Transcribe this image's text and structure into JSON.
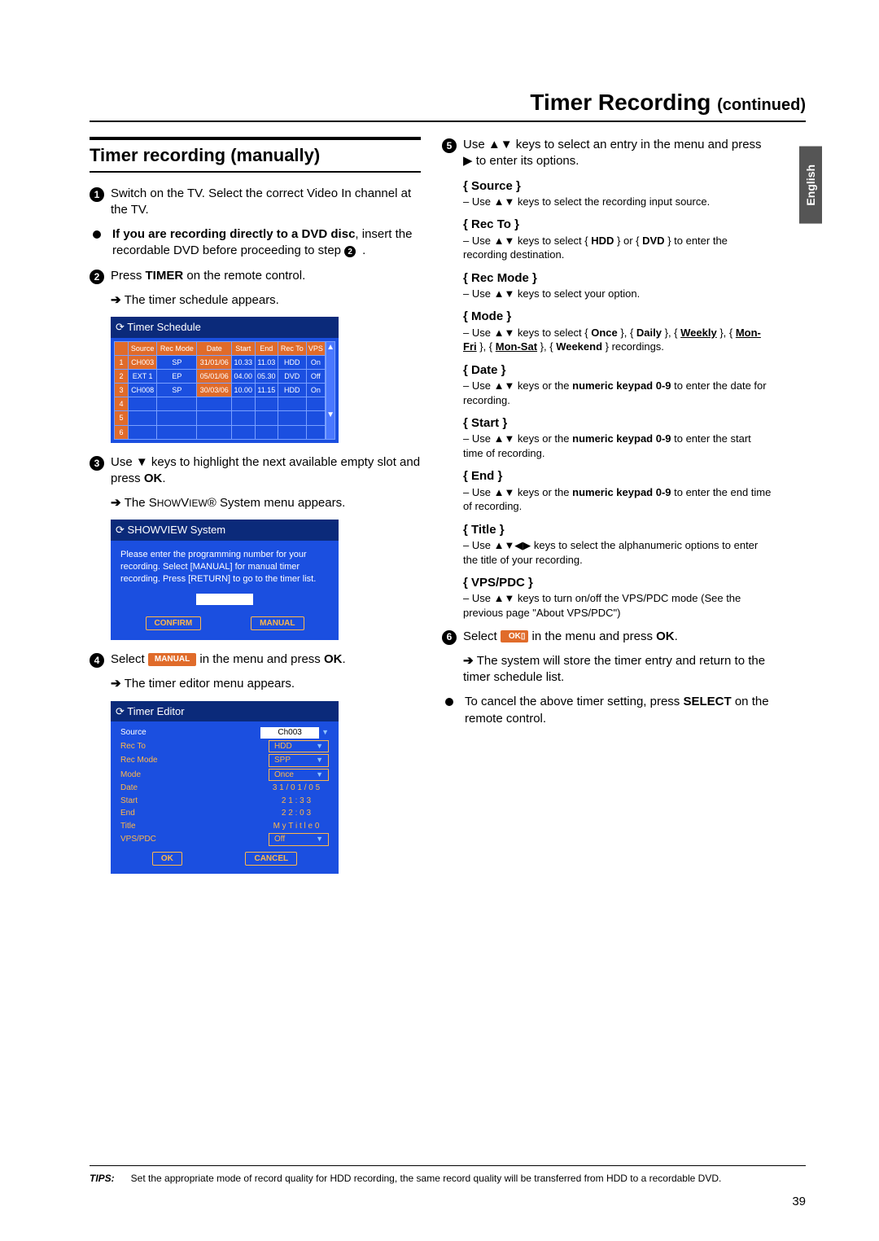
{
  "header": {
    "title": "Timer Recording",
    "continued": "(continued)"
  },
  "lang_tab": "English",
  "left": {
    "section_title": "Timer recording (manually)",
    "step1": "Switch on the TV. Select the correct Video In channel at the TV.",
    "bullet_dvd_a": "If you are recording directly to a DVD disc",
    "bullet_dvd_b": ", insert the recordable DVD before proceeding to step ",
    "bullet_dvd_ref": "2",
    "step2_a": "Press ",
    "step2_b": "TIMER",
    "step2_c": " on the remote control.",
    "step2_sub": "The timer schedule appears.",
    "schedule": {
      "title": "Timer Schedule",
      "headers": [
        "",
        "Source",
        "Rec Mode",
        "Date",
        "Start",
        "End",
        "Rec To",
        "VPS"
      ],
      "rows": [
        {
          "n": "1",
          "source": "CH003",
          "mode": "SP",
          "date": "31/01/06",
          "start": "10.33",
          "end": "11.03",
          "to": "HDD",
          "vps": "On"
        },
        {
          "n": "2",
          "source": "EXT 1",
          "mode": "EP",
          "date": "05/01/06",
          "start": "04.00",
          "end": "05.30",
          "to": "DVD",
          "vps": "Off"
        },
        {
          "n": "3",
          "source": "CH008",
          "mode": "SP",
          "date": "30/03/06",
          "start": "10.00",
          "end": "11.15",
          "to": "HDD",
          "vps": "On"
        },
        {
          "n": "4",
          "source": "",
          "mode": "",
          "date": "",
          "start": "",
          "end": "",
          "to": "",
          "vps": ""
        },
        {
          "n": "5",
          "source": "",
          "mode": "",
          "date": "",
          "start": "",
          "end": "",
          "to": "",
          "vps": ""
        },
        {
          "n": "6",
          "source": "",
          "mode": "",
          "date": "",
          "start": "",
          "end": "",
          "to": "",
          "vps": ""
        }
      ]
    },
    "step3_a": "Use ▼ keys to highlight the next available empty slot and press ",
    "step3_b": "OK",
    "step3_c": ".",
    "step3_sub_a": "The S",
    "step3_sub_b": "HOW",
    "step3_sub_c": "V",
    "step3_sub_d": "IEW",
    "step3_sub_e": "® System menu appears.",
    "sv": {
      "title": "SHOWVIEW System",
      "body": "Please enter the programming number for your recording. Select [MANUAL] for manual timer recording. Press [RETURN] to go to the timer list.",
      "confirm": "CONFIRM",
      "manual": "MANUAL"
    },
    "step4_a": "Select ",
    "step4_chip": "MANUAL",
    "step4_b": " in the menu and press ",
    "step4_c": "OK",
    "step4_d": ".",
    "step4_sub": "The timer editor menu appears.",
    "editor": {
      "title": "Timer Editor",
      "rows": [
        {
          "lbl": "Source",
          "val": "Ch003",
          "boxed": false,
          "sel": true,
          "tri": true
        },
        {
          "lbl": "Rec To",
          "val": "HDD",
          "boxed": true,
          "tri": true
        },
        {
          "lbl": "Rec Mode",
          "val": "SPP",
          "boxed": true,
          "tri": true
        },
        {
          "lbl": "Mode",
          "val": "Once",
          "boxed": true,
          "tri": true
        },
        {
          "lbl": "Date",
          "val": "3 1 / 0 1 / 0 5",
          "plain": true
        },
        {
          "lbl": "Start",
          "val": "2 1 : 3 3",
          "plain": true
        },
        {
          "lbl": "End",
          "val": "2 2 : 0 3",
          "plain": true
        },
        {
          "lbl": "Title",
          "val": "M y T i t l e 0",
          "plain": true
        },
        {
          "lbl": "VPS/PDC",
          "val": "Off",
          "boxed": true,
          "tri": true
        }
      ],
      "ok": "OK",
      "cancel": "CANCEL"
    }
  },
  "right": {
    "step5": "Use ▲▼ keys to select an entry in the menu and press ▶ to enter its options.",
    "options": [
      {
        "label": "{ Source }",
        "desc": "– Use ▲▼ keys to select the recording input source."
      },
      {
        "label": "{ Rec To }",
        "desc_parts": [
          "– Use ▲▼ keys to select { ",
          "HDD",
          " } or { ",
          "DVD",
          " } to enter the recording destination."
        ]
      },
      {
        "label": "{ Rec Mode }",
        "desc": "– Use ▲▼ keys to select your option."
      },
      {
        "label": "{ Mode }",
        "desc_parts": [
          "– Use ▲▼ keys to select { ",
          "Once",
          " }, { ",
          "Daily",
          " }, { ",
          "Weekly",
          " }, { ",
          "Mon-Fri",
          " }, { ",
          "Mon-Sat",
          " }, { ",
          "Weekend",
          " } recordings."
        ]
      },
      {
        "label": "{ Date }",
        "desc_parts": [
          "– Use ▲▼ keys or the ",
          "numeric keypad 0-9",
          " to enter the date for recording."
        ]
      },
      {
        "label": "{ Start }",
        "desc_parts": [
          "– Use ▲▼ keys or the ",
          "numeric keypad 0-9",
          " to enter the start time of recording."
        ]
      },
      {
        "label": "{ End }",
        "desc_parts": [
          "– Use ▲▼ keys or the ",
          "numeric keypad 0-9",
          " to enter the end time of recording."
        ]
      },
      {
        "label": "{ Title }",
        "desc": "– Use ▲▼◀▶ keys to select the alphanumeric options to enter the title of your recording."
      },
      {
        "label": "{ VPS/PDC }",
        "desc": "– Use ▲▼ keys to turn on/off the VPS/PDC mode (See the previous page \"About VPS/PDC\")"
      }
    ],
    "step6_a": "Select ",
    "step6_chip": "OK",
    "step6_b": " in the menu and press ",
    "step6_c": "OK",
    "step6_d": ".",
    "step6_sub": "The system will store the timer entry and return to the timer schedule list.",
    "cancel_a": "To cancel the above timer setting, press ",
    "cancel_b": "SELECT",
    "cancel_c": " on the remote control."
  },
  "tips": {
    "label": "TIPS:",
    "text": "Set the appropriate mode of record quality for HDD recording, the same record quality will be transferred from HDD to a recordable DVD."
  },
  "page_number": "39"
}
